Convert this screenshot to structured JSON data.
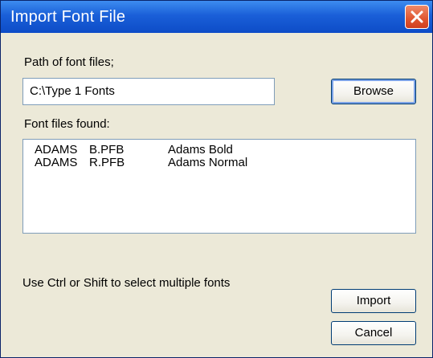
{
  "window": {
    "title": "Import Font File",
    "close_icon": "close-icon"
  },
  "path": {
    "label": "Path of font files;",
    "value": "C:\\Type 1 Fonts",
    "browse_label": "Browse"
  },
  "found": {
    "label": "Font files found:",
    "files": [
      {
        "name": "ADAMS",
        "file": "B.PFB",
        "description": "Adams Bold"
      },
      {
        "name": "ADAMS",
        "file": "R.PFB",
        "description": "Adams Normal"
      }
    ]
  },
  "hint": "Use Ctrl or Shift to select multiple fonts",
  "actions": {
    "import_label": "Import",
    "cancel_label": "Cancel"
  },
  "colors": {
    "titlebar": "#1a5fd8",
    "close": "#e0552f",
    "dialog_bg": "#ece9d8"
  }
}
